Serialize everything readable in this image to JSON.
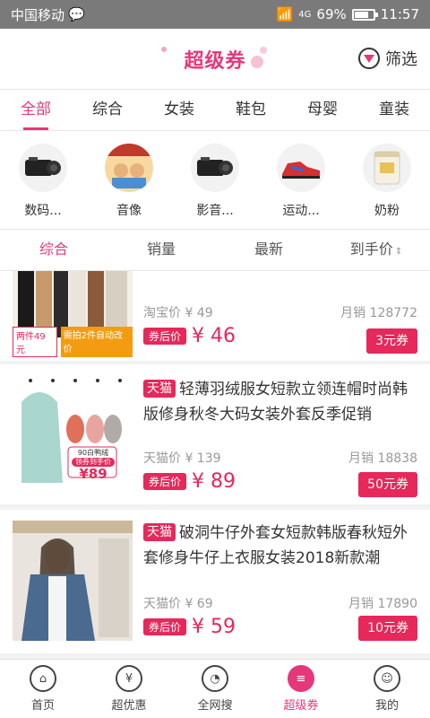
{
  "status": {
    "carrier": "中国移动",
    "signal": "4G",
    "battery": "69%",
    "time": "11:57",
    "battery_level": 0.69
  },
  "header": {
    "title": "超级券",
    "filter_label": "筛选"
  },
  "tabs": [
    "全部",
    "综合",
    "女装",
    "鞋包",
    "母婴",
    "童装"
  ],
  "categories": [
    {
      "label": "数码...",
      "icon": "camcorder-icon"
    },
    {
      "label": "音像",
      "icon": "book-cover-icon"
    },
    {
      "label": "影音...",
      "icon": "camcorder-icon"
    },
    {
      "label": "运动...",
      "icon": "sneaker-icon"
    },
    {
      "label": "奶粉",
      "icon": "milk-powder-icon"
    }
  ],
  "sort": {
    "items": [
      "综合",
      "销量",
      "最新",
      "到手价"
    ],
    "arrow": "⇕"
  },
  "products": [
    {
      "tag": "",
      "title": "",
      "orig_label": "淘宝价",
      "orig_price": "¥ 49",
      "sales": "月销 128772",
      "badge": "券后价",
      "price": "¥ 46",
      "coupon": "3元券",
      "thumb_text": "两件49元",
      "thumb_text2": "需拍2件自动改价"
    },
    {
      "tag": "天猫",
      "title": "轻薄羽绒服女短款立领连帽时尚韩版修身秋冬大码女装外套反季促销",
      "orig_label": "天猫价",
      "orig_price": "¥ 139",
      "sales": "月销 18838",
      "badge": "券后价",
      "price": "¥ 89",
      "coupon": "50元券",
      "thumb_text": "90白鸭绒",
      "thumb_text2": "领券到手价",
      "thumb_price": "¥89"
    },
    {
      "tag": "天猫",
      "title": "破洞牛仔外套女短款韩版春秋短外套修身牛仔上衣服女装2018新款潮",
      "orig_label": "天猫价",
      "orig_price": "¥ 69",
      "sales": "月销 17890",
      "badge": "券后价",
      "price": "¥ 59",
      "coupon": "10元券"
    }
  ],
  "bottom_nav": [
    {
      "label": "首页",
      "icon": "home-icon",
      "glyph": "⌂"
    },
    {
      "label": "超优惠",
      "icon": "yen-icon",
      "glyph": "¥"
    },
    {
      "label": "全网搜",
      "icon": "search-face-icon",
      "glyph": "◔"
    },
    {
      "label": "超级券",
      "icon": "coupon-icon",
      "glyph": "≡"
    },
    {
      "label": "我的",
      "icon": "smile-icon",
      "glyph": "☺"
    }
  ],
  "colors": {
    "accent": "#e6377a",
    "price": "#e6285a"
  }
}
